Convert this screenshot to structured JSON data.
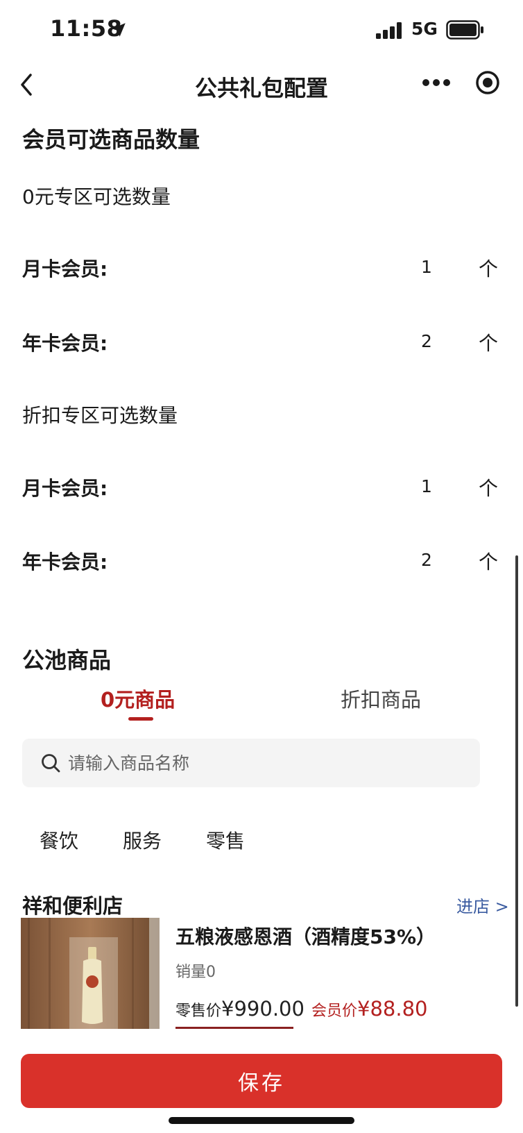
{
  "status_bar": {
    "time": "11:58",
    "network": "5G"
  },
  "nav": {
    "title": "公共礼包配置"
  },
  "member_quantity": {
    "title": "会员可选商品数量",
    "groups": [
      {
        "title": "0元专区可选数量",
        "rows": [
          {
            "label": "月卡会员:",
            "value": "1",
            "unit": "个"
          },
          {
            "label": "年卡会员:",
            "value": "2",
            "unit": "个"
          }
        ]
      },
      {
        "title": "折扣专区可选数量",
        "rows": [
          {
            "label": "月卡会员:",
            "value": "1",
            "unit": "个"
          },
          {
            "label": "年卡会员:",
            "value": "2",
            "unit": "个"
          }
        ]
      }
    ]
  },
  "pool": {
    "title": "公池商品",
    "tabs": [
      {
        "label": "0元商品",
        "active": true
      },
      {
        "label": "折扣商品",
        "active": false
      }
    ],
    "search": {
      "placeholder": "请输入商品名称",
      "value": ""
    },
    "categories": [
      "餐饮",
      "服务",
      "零售"
    ]
  },
  "store": {
    "name": "祥和便利店",
    "enter_label": "进店 >",
    "product": {
      "name": "五粮液感恩酒（酒精度53%）",
      "sales": "销量0",
      "retail_label": "零售价",
      "retail_price": "¥990.00",
      "member_label": "会员价",
      "member_price": "¥88.80"
    }
  },
  "save_label": "保存",
  "colors": {
    "accent": "#b3201f",
    "save_button": "#d9312a",
    "link": "#3a5ba0"
  }
}
